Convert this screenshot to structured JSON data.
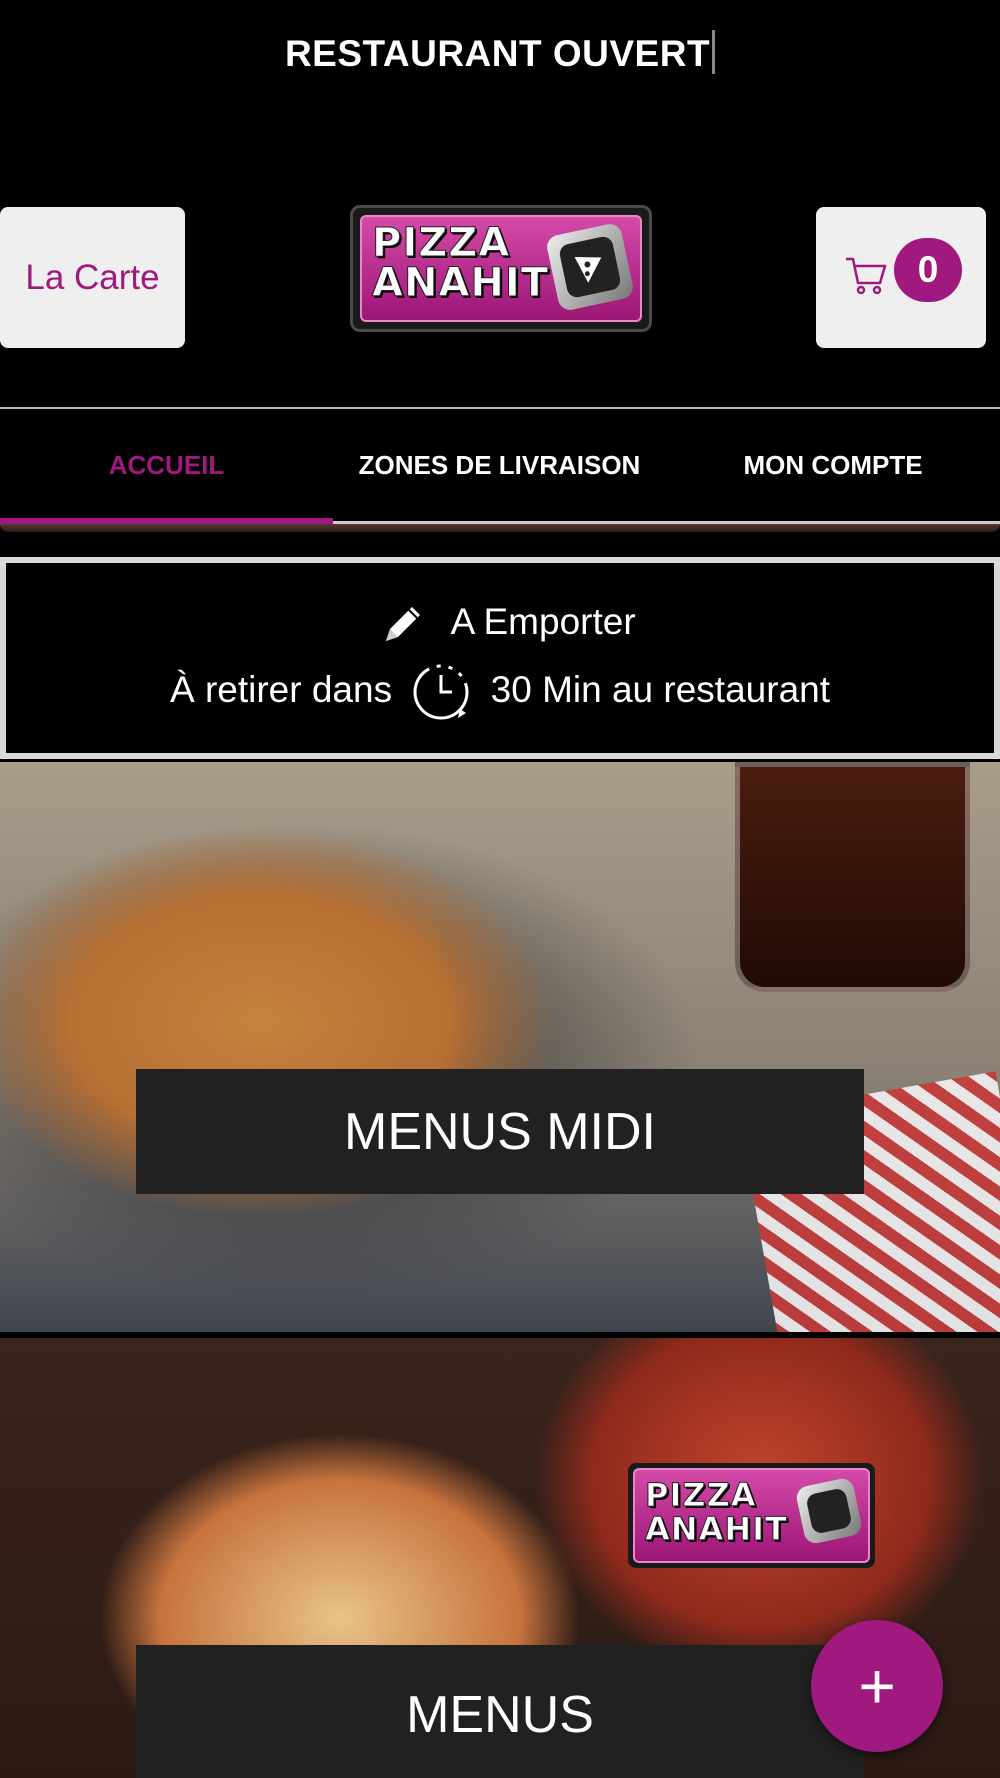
{
  "status": {
    "text": "RESTAURANT OUVERT"
  },
  "header": {
    "carte_label": "La Carte",
    "logo_text": "PIZZA ANAHIT",
    "cart_count": "0"
  },
  "tabs": [
    {
      "label": "ACCUEIL",
      "active": true
    },
    {
      "label": "ZONES DE LIVRAISON",
      "active": false
    },
    {
      "label": "MON COMPTE",
      "active": false
    }
  ],
  "service": {
    "mode": "A Emporter",
    "pickup_prefix": "À retirer dans",
    "pickup_suffix": "30 Min au restaurant"
  },
  "banners": [
    {
      "label": "MENUS MIDI"
    },
    {
      "label": "MENUS",
      "logo_text": "PIZZA ANAHIT"
    }
  ],
  "fab": {
    "label": "+"
  },
  "colors": {
    "accent": "#a0197e",
    "background": "#000000",
    "label_bg": "#212121"
  }
}
